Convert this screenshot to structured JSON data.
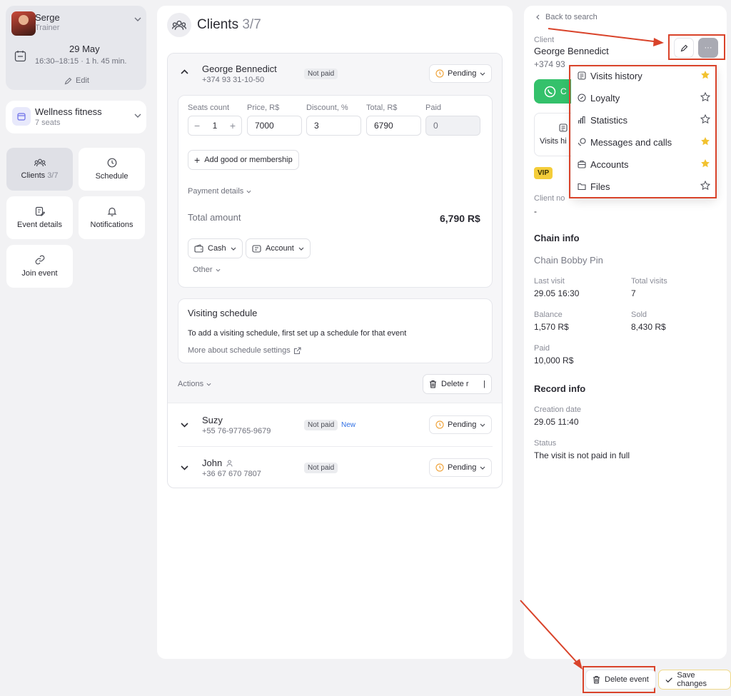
{
  "sidebar": {
    "user": {
      "name": "Serge",
      "role": "Trainer"
    },
    "event": {
      "date": "29 May",
      "time": "16:30–18:15 · 1 h. 45 min.",
      "edit_label": "Edit"
    },
    "venue": {
      "name": "Wellness fitness",
      "seats": "7 seats"
    },
    "nav": [
      {
        "label": "Clients",
        "count": "3/7",
        "icon": "clients-icon"
      },
      {
        "label": "Schedule",
        "icon": "clock-icon"
      },
      {
        "label": "Event details",
        "icon": "edit-doc-icon"
      },
      {
        "label": "Notifications",
        "icon": "bell-icon"
      },
      {
        "label": "Join event",
        "icon": "link-icon"
      }
    ]
  },
  "main": {
    "title": "Clients",
    "count": "3/7",
    "clients": [
      {
        "name": "George Bennedict",
        "phone": "+374 93 31-10-50",
        "payment": "Not paid",
        "status": "Pending"
      },
      {
        "name": "Suzy",
        "phone": "+55 76-97765-9679",
        "payment": "Not paid",
        "tag": "New",
        "status": "Pending"
      },
      {
        "name": "John",
        "phone": "+36 67 670 7807",
        "payment": "Not paid",
        "status": "Pending"
      }
    ],
    "form": {
      "seats_label": "Seats count",
      "seats_minus": "−",
      "seats_value": "1",
      "seats_plus": "+",
      "price_label": "Price, R$",
      "price_value": "7000",
      "discount_label": "Discount, %",
      "discount_value": "3",
      "total_label": "Total, R$",
      "total_value": "6790",
      "paid_label": "Paid",
      "paid_value": "0",
      "add_good_label": "Add good or membership",
      "payment_details_label": "Payment details",
      "total_amount_label": "Total amount",
      "total_amount_value": "6,790 R$",
      "cash_label": "Cash",
      "account_label": "Account",
      "other_label": "Other"
    },
    "schedule": {
      "title": "Visiting schedule",
      "text": "To add a visiting schedule, first set up a schedule for that event",
      "link": "More about schedule settings"
    },
    "actions_label": "Actions",
    "delete_label": "Delete r"
  },
  "right": {
    "back_label": "Back to search",
    "client_label": "Client",
    "client_name": "George Bennedict",
    "client_phone": "+374 93",
    "visits_short": "Visits hi",
    "vip": "VIP",
    "client_notes_label": "Client no",
    "client_notes_value": "-",
    "chain_head": "Chain info",
    "chain_name": "Chain Bobby Pin",
    "last_visit_label": "Last visit",
    "last_visit_value": "29.05 16:30",
    "total_visits_label": "Total visits",
    "total_visits_value": "7",
    "balance_label": "Balance",
    "balance_value": "1,570 R$",
    "sold_label": "Sold",
    "sold_value": "8,430 R$",
    "paid_label": "Paid",
    "paid_value": "10,000 R$",
    "record_head": "Record info",
    "creation_label": "Creation date",
    "creation_value": "29.05 11:40",
    "status_label": "Status",
    "status_value": "The visit is not paid in full",
    "more_label": "···"
  },
  "dropdown": {
    "items": [
      {
        "label": "Visits history",
        "icon": "visits-history-icon",
        "starred": true
      },
      {
        "label": "Loyalty",
        "icon": "loyalty-icon",
        "starred": false
      },
      {
        "label": "Statistics",
        "icon": "statistics-icon",
        "starred": false
      },
      {
        "label": "Messages and calls",
        "icon": "messages-icon",
        "starred": true
      },
      {
        "label": "Accounts",
        "icon": "accounts-icon",
        "starred": true
      },
      {
        "label": "Files",
        "icon": "folder-icon",
        "starred": false
      }
    ]
  },
  "footer": {
    "delete_event_label": "Delete event",
    "save_label": "Save changes"
  },
  "colors": {
    "accent_red": "#d9432a",
    "whatsapp_green": "#34c16b",
    "star_yellow": "#f2c230",
    "pending_orange": "#f0a640",
    "new_blue": "#2f6fe4"
  }
}
